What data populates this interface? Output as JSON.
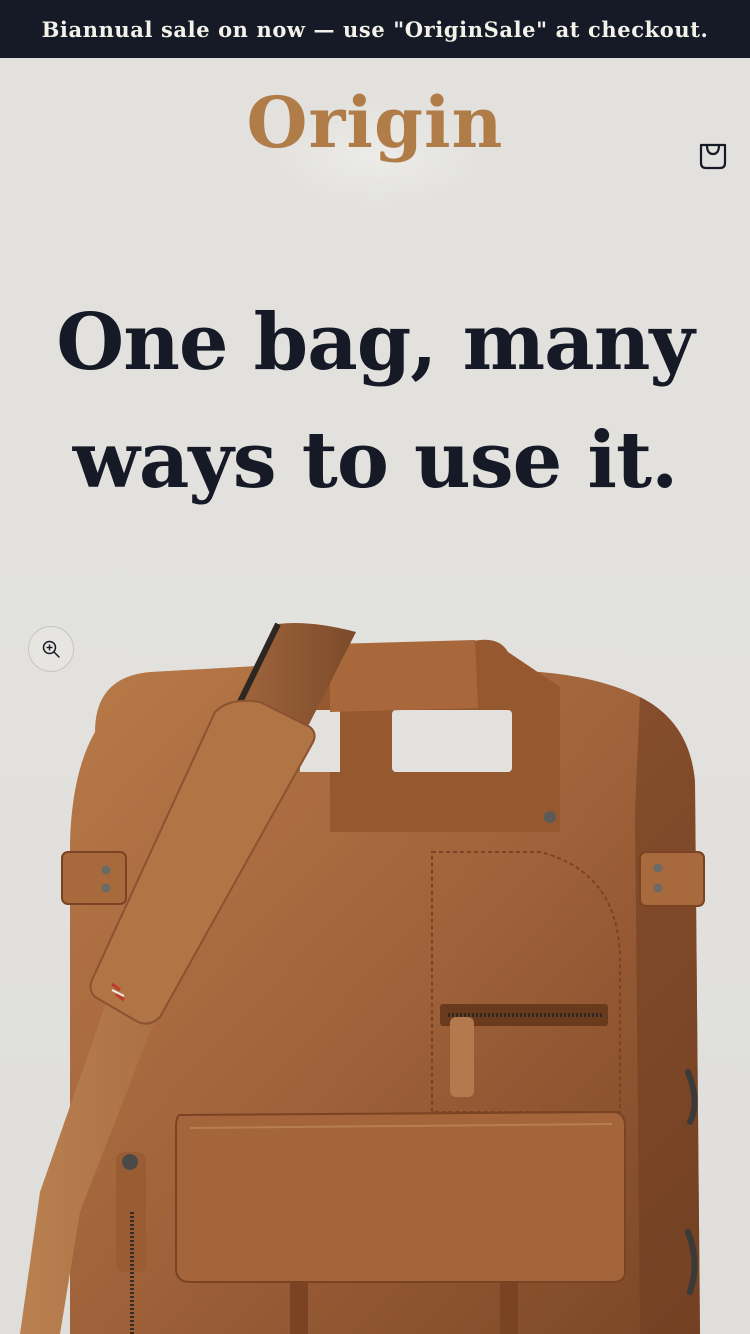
{
  "announcement": {
    "text": "Biannual sale on now — use \"OriginSale\" at checkout."
  },
  "header": {
    "logo_text": "Origin",
    "cart_icon": "shopping-bag-icon"
  },
  "hero": {
    "headline_line1": "One bag, many",
    "headline_line2": "ways to use it.",
    "zoom_icon": "zoom-in-icon",
    "image_description_icon": "leather-bag-image"
  },
  "colors": {
    "announcement_bg": "#161a26",
    "page_bg": "#e2e1dd",
    "logo": "#b07d48",
    "headline": "#161a26",
    "leather": "#a5673a"
  }
}
